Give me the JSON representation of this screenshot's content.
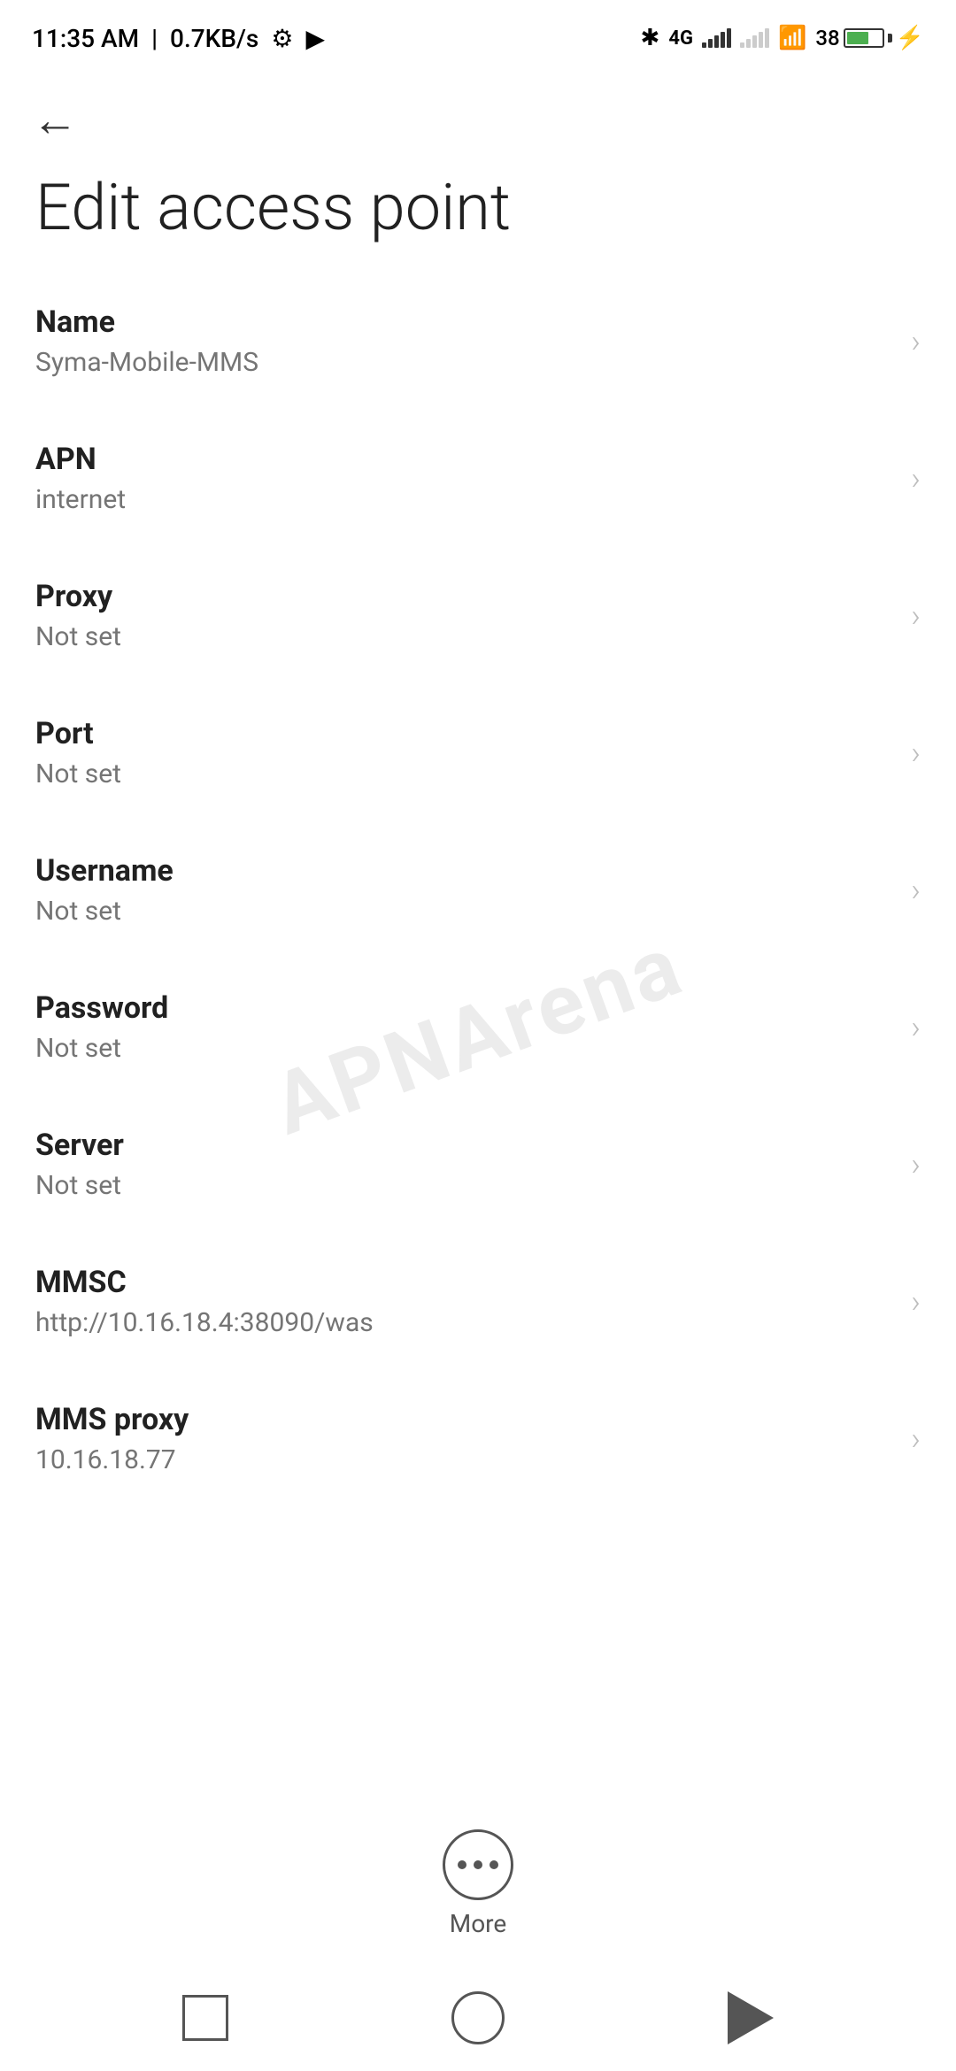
{
  "statusBar": {
    "time": "11:35 AM",
    "speed": "0.7KB/s"
  },
  "page": {
    "title": "Edit access point",
    "back_label": "←"
  },
  "settings": [
    {
      "id": "name",
      "title": "Name",
      "value": "Syma-Mobile-MMS"
    },
    {
      "id": "apn",
      "title": "APN",
      "value": "internet"
    },
    {
      "id": "proxy",
      "title": "Proxy",
      "value": "Not set"
    },
    {
      "id": "port",
      "title": "Port",
      "value": "Not set"
    },
    {
      "id": "username",
      "title": "Username",
      "value": "Not set"
    },
    {
      "id": "password",
      "title": "Password",
      "value": "Not set"
    },
    {
      "id": "server",
      "title": "Server",
      "value": "Not set"
    },
    {
      "id": "mmsc",
      "title": "MMSC",
      "value": "http://10.16.18.4:38090/was"
    },
    {
      "id": "mms-proxy",
      "title": "MMS proxy",
      "value": "10.16.18.77"
    }
  ],
  "more": {
    "label": "More"
  },
  "watermark": "APNArena"
}
